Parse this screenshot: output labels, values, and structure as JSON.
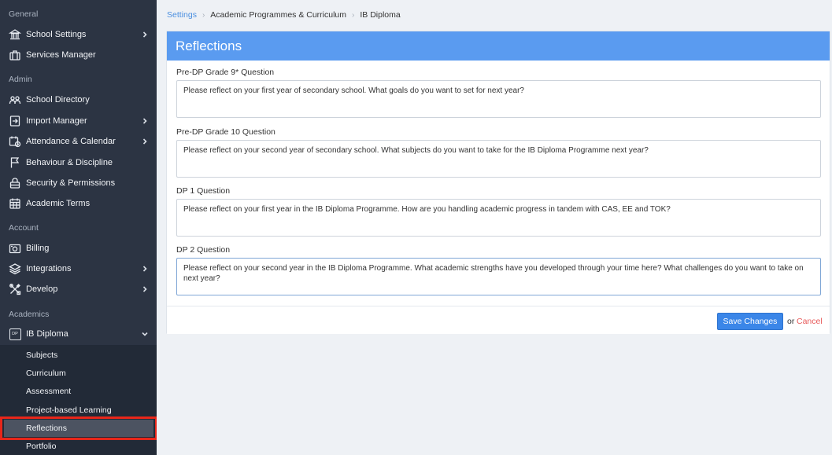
{
  "sidebar": {
    "sections": {
      "general": "General",
      "admin": "Admin",
      "account": "Account",
      "academics": "Academics"
    },
    "items": {
      "school_settings": "School Settings",
      "services_manager": "Services Manager",
      "school_directory": "School Directory",
      "import_manager": "Import Manager",
      "attendance_calendar": "Attendance & Calendar",
      "behaviour_discipline": "Behaviour & Discipline",
      "security_permissions": "Security & Permissions",
      "academic_terms": "Academic Terms",
      "billing": "Billing",
      "integrations": "Integrations",
      "develop": "Develop",
      "ib_diploma": "IB Diploma",
      "dp_badge": "DP"
    },
    "subitems": {
      "subjects": "Subjects",
      "curriculum": "Curriculum",
      "assessment": "Assessment",
      "project_based_learning": "Project-based Learning",
      "reflections": "Reflections",
      "portfolio": "Portfolio"
    }
  },
  "breadcrumb": {
    "settings": "Settings",
    "academic": "Academic Programmes & Curriculum",
    "current": "IB Diploma"
  },
  "panel": {
    "title": "Reflections",
    "questions": [
      {
        "label": "Pre-DP Grade 9* Question",
        "value": "Please reflect on your first year of secondary school. What goals do you want to set for next year?"
      },
      {
        "label": "Pre-DP Grade 10 Question",
        "value": "Please reflect on your second year of secondary school. What subjects do you want to take for the IB Diploma Programme next year?"
      },
      {
        "label": "DP 1 Question",
        "value": "Please reflect on your first year in the IB Diploma Programme. How are you handling academic progress in tandem with CAS, EE and TOK?"
      },
      {
        "label": "DP 2 Question",
        "value": "Please reflect on your second year in the IB Diploma Programme. What academic strengths have you developed through your time here? What challenges do you want to take on next year?"
      }
    ],
    "save_label": "Save Changes",
    "or_text": "or",
    "cancel_label": "Cancel"
  },
  "colors": {
    "sidebar_bg": "#2c3443",
    "accent": "#5a9bf0",
    "save_button": "#3b86e8",
    "cancel": "#e85a5a",
    "highlight": "#e8261a"
  },
  "icons": [
    "building-icon",
    "briefcase-icon",
    "people-icon",
    "import-icon",
    "calendar-clock-icon",
    "flag-icon",
    "lock-icon",
    "calendar-grid-icon",
    "camera-card-icon",
    "layers-icon",
    "tools-icon",
    "dp-badge-icon",
    "chevron-right-icon",
    "chevron-down-icon"
  ]
}
